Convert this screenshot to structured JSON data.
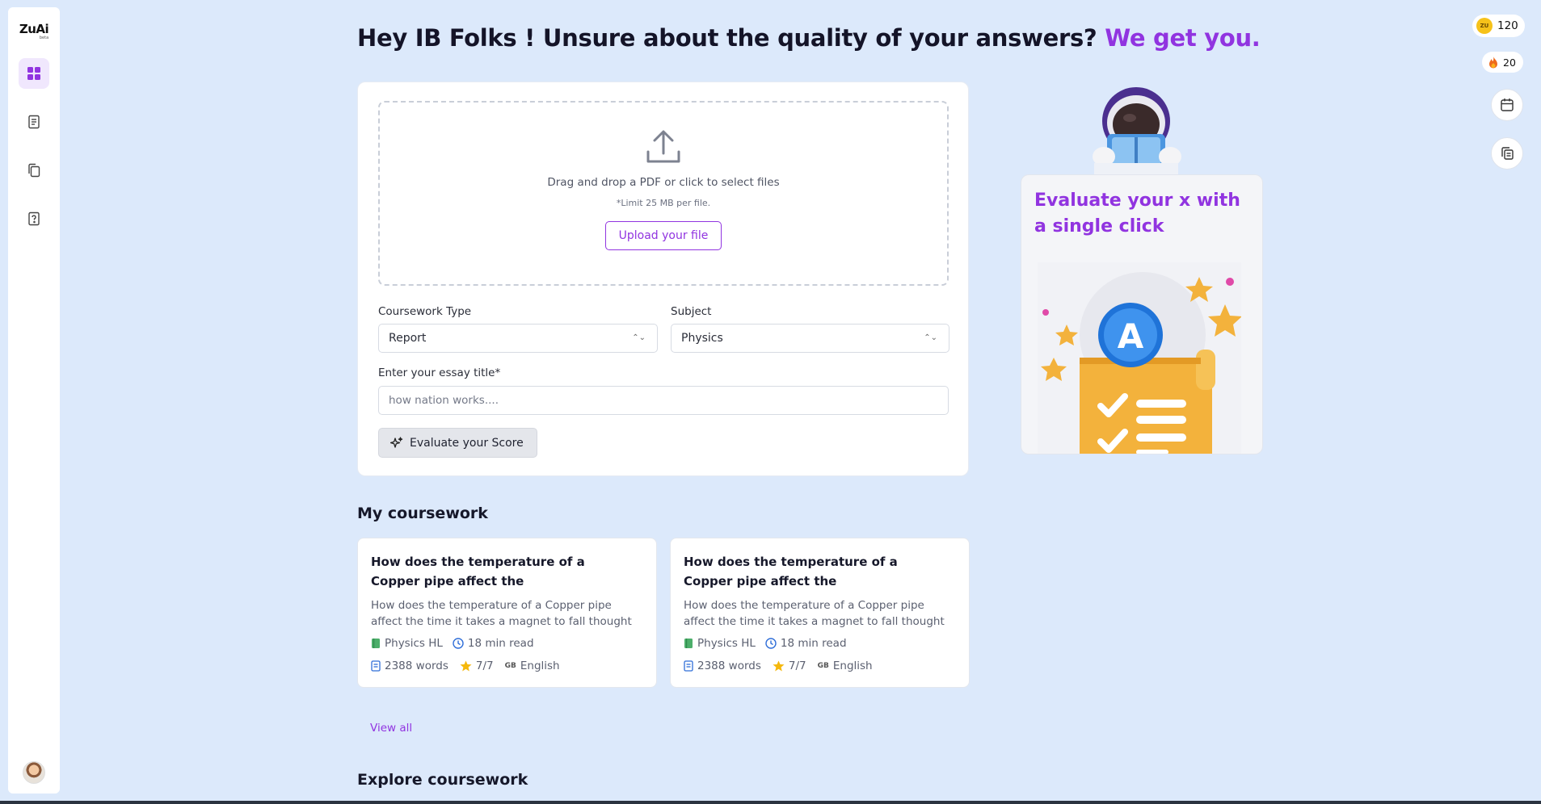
{
  "sidebar": {
    "logo": "ZuAi",
    "logo_tag": "beta",
    "items": [
      {
        "name": "dashboard",
        "icon": "grid-icon",
        "active": true
      },
      {
        "name": "notes",
        "icon": "document-icon",
        "active": false
      },
      {
        "name": "copies",
        "icon": "copy-icon",
        "active": false
      },
      {
        "name": "quiz",
        "icon": "question-icon",
        "active": false
      }
    ]
  },
  "header": {
    "headline": "Hey IB Folks ! Unsure about the quality of your answers?",
    "headline_accent": "We get you."
  },
  "upload": {
    "drop_text": "Drag and drop a PDF or click to select files",
    "limit_text": "*Limit 25 MB per file.",
    "button_label": "Upload your file",
    "coursework_type_label": "Coursework Type",
    "coursework_type_value": "Report",
    "subject_label": "Subject",
    "subject_value": "Physics",
    "title_label": "Enter your essay title*",
    "title_placeholder": "how nation works....",
    "evaluate_label": "Evaluate your Score"
  },
  "promo": {
    "title": "Evaluate your x with a single click",
    "badge_letter": "A"
  },
  "rail": {
    "coins": "120",
    "coin_badge": "ZU",
    "streak": "20"
  },
  "coursework": {
    "section_title": "My coursework",
    "cards": [
      {
        "title": "How does the temperature of a Copper pipe affect the",
        "desc": "How does the temperature of a Copper pipe affect the time it takes a magnet to fall thought",
        "subject": "Physics HL",
        "read_time": "18 min read",
        "words": "2388 words",
        "rating": "7/7",
        "lang_flag": "GB",
        "language": "English"
      },
      {
        "title": "How does the temperature of a Copper pipe affect the",
        "desc": "How does the temperature of a Copper pipe affect the time it takes a magnet to fall thought",
        "subject": "Physics HL",
        "read_time": "18 min read",
        "words": "2388 words",
        "rating": "7/7",
        "lang_flag": "GB",
        "language": "English"
      }
    ],
    "view_all": "View all"
  },
  "explore": {
    "section_title": "Explore coursework"
  },
  "colors": {
    "accent": "#9134e0",
    "background": "#dce9fb"
  }
}
